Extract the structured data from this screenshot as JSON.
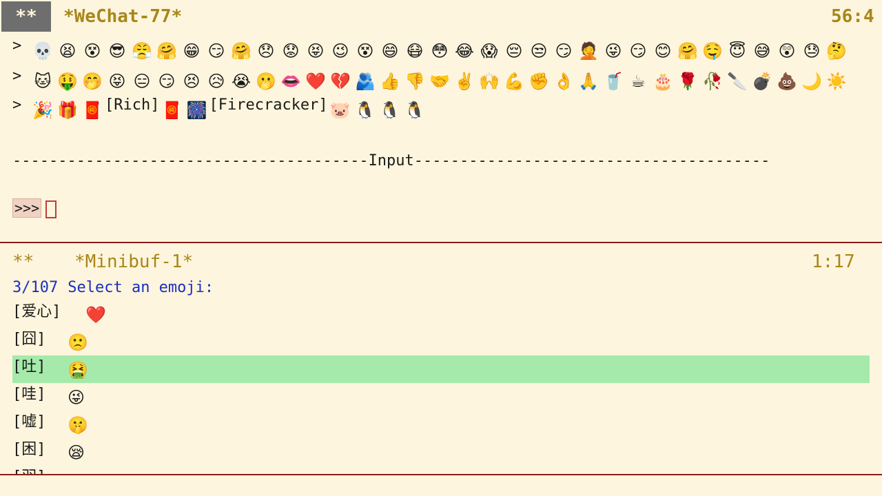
{
  "top_modeline": {
    "state": "**",
    "buffer": "*WeChat-77*",
    "position": "56:4"
  },
  "chat_lines": [
    {
      "prompt": ">",
      "items": [
        "💀",
        "😫",
        "😵",
        "😎",
        "😤",
        "🤗",
        "😁",
        "😏",
        "🤗",
        "😞",
        "😟",
        "😝",
        "😉",
        "😵",
        "😄",
        "😷",
        "😳",
        "😂",
        "😱",
        "😔",
        "😒",
        "😏",
        "🤦",
        "😜",
        "😏",
        "😊",
        "🤗",
        "🤤",
        "😇",
        "😅",
        "😲",
        "😓",
        "🤔"
      ]
    },
    {
      "prompt": ">",
      "items": [
        "🐱",
        "🤑",
        "🤭",
        "😝",
        "😑",
        "😏",
        "😣",
        "😥",
        "😭",
        "🫢",
        "👄",
        "❤️",
        "💔",
        "🫂",
        "👍",
        "👎",
        "🤝",
        "✌️",
        "🙌",
        "💪",
        "✊",
        "👌",
        "🙏",
        "🥤",
        "☕",
        "🎂",
        "🌹",
        "🥀",
        "🔪",
        "💣",
        "💩",
        "🌙",
        "☀️"
      ]
    },
    {
      "prompt": ">",
      "items": [
        "🎉",
        "🎁",
        "🧧",
        "[Rich]",
        "🧧",
        "🎆",
        "[Firecracker]",
        "🐷",
        "🐧",
        "🐧",
        "🐧"
      ]
    }
  ],
  "separator": {
    "left": "---------------------------------------",
    "label": "Input",
    "right": "---------------------------------------"
  },
  "input": {
    "prompt": ">>>",
    "value": ""
  },
  "mini_modeline": {
    "state": "**",
    "buffer": "*Minibuf-1*",
    "position": "1:17"
  },
  "minibuffer": {
    "count": "3/107",
    "prompt": "Select an emoji:"
  },
  "candidates": [
    {
      "label": "[爱心]",
      "icon": "❤️",
      "selected": false
    },
    {
      "label": "[囧]",
      "icon": "🙁",
      "selected": false
    },
    {
      "label": "[吐]",
      "icon": "🤮",
      "selected": true
    },
    {
      "label": "[哇]",
      "icon": "😜",
      "selected": false
    },
    {
      "label": "[嘘]",
      "icon": "🤫",
      "selected": false
    },
    {
      "label": "[困]",
      "icon": "😪",
      "selected": false
    },
    {
      "label": "[羽]",
      "icon": "",
      "selected": false
    }
  ]
}
